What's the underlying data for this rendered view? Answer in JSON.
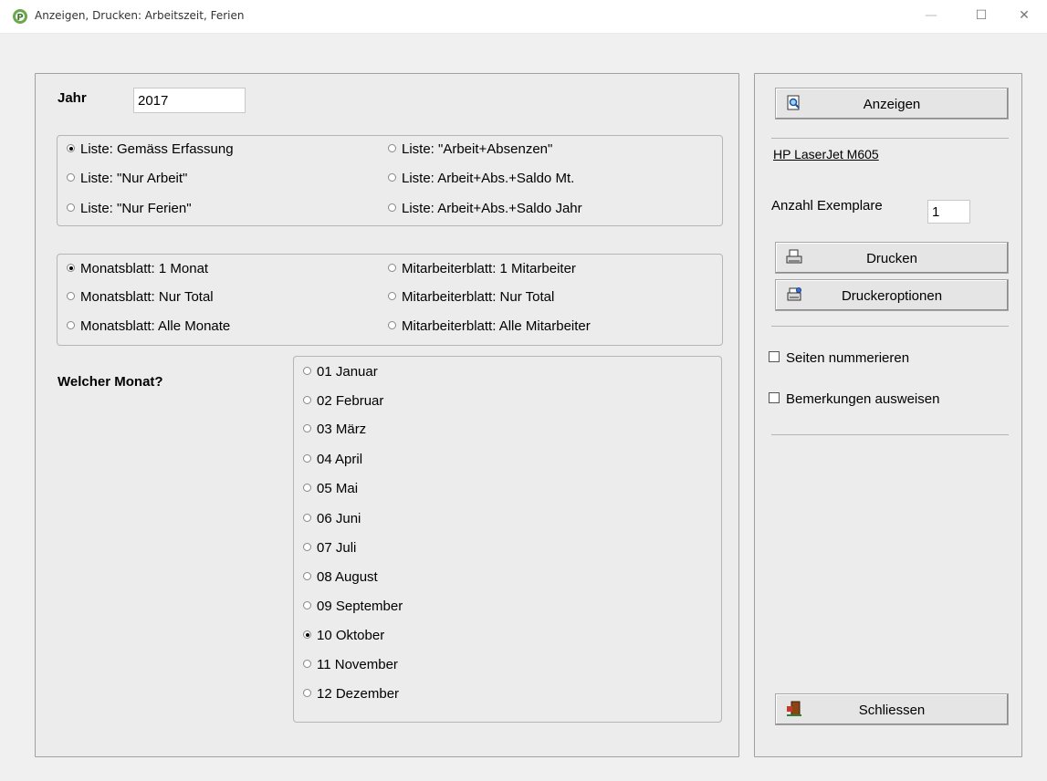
{
  "window": {
    "title": "Anzeigen, Drucken: Arbeitszeit, Ferien",
    "minimize": "—",
    "maximize": "☐",
    "close": "✕"
  },
  "left": {
    "year_label": "Jahr",
    "year_value": "2017",
    "list_options": [
      {
        "label": "Liste: Gemäss Erfassung",
        "checked": true
      },
      {
        "label": "Liste: \"Nur Arbeit\"",
        "checked": false
      },
      {
        "label": "Liste: \"Nur Ferien\"",
        "checked": false
      },
      {
        "label": "Liste: \"Arbeit+Absenzen\"",
        "checked": false
      },
      {
        "label": "Liste: Arbeit+Abs.+Saldo Mt.",
        "checked": false
      },
      {
        "label": "Liste: Arbeit+Abs.+Saldo Jahr",
        "checked": false
      }
    ],
    "sheet_options": [
      {
        "label": "Monatsblatt: 1 Monat",
        "checked": true
      },
      {
        "label": "Monatsblatt: Nur Total",
        "checked": false
      },
      {
        "label": "Monatsblatt: Alle  Monate",
        "checked": false
      },
      {
        "label": "Mitarbeiterblatt: 1 Mitarbeiter",
        "checked": false
      },
      {
        "label": "Mitarbeiterblatt: Nur Total",
        "checked": false
      },
      {
        "label": "Mitarbeiterblatt: Alle Mitarbeiter",
        "checked": false
      }
    ],
    "month_label": "Welcher Monat?",
    "months": [
      {
        "label": "01 Januar",
        "checked": false
      },
      {
        "label": "02 Februar",
        "checked": false
      },
      {
        "label": "03 März",
        "checked": false
      },
      {
        "label": "04 April",
        "checked": false
      },
      {
        "label": "05 Mai",
        "checked": false
      },
      {
        "label": "06 Juni",
        "checked": false
      },
      {
        "label": "07 Juli",
        "checked": false
      },
      {
        "label": "08 August",
        "checked": false
      },
      {
        "label": "09 September",
        "checked": false
      },
      {
        "label": "10 Oktober",
        "checked": true
      },
      {
        "label": "11 November",
        "checked": false
      },
      {
        "label": "12 Dezember",
        "checked": false
      }
    ]
  },
  "right": {
    "show_button": "Anzeigen",
    "printer_name": "HP LaserJet M605",
    "copies_label": "Anzahl Exemplare",
    "copies_value": "1",
    "print_button": "Drucken",
    "printer_options_button": "Druckeroptionen",
    "number_pages": "Seiten nummerieren",
    "show_remarks": "Bemerkungen ausweisen",
    "close_button": "Schliessen"
  },
  "icons": {
    "app": "app-logo-icon",
    "show": "magnifier-page-icon",
    "print": "printer-icon",
    "printer_options": "printer-settings-icon",
    "close": "exit-door-icon"
  }
}
